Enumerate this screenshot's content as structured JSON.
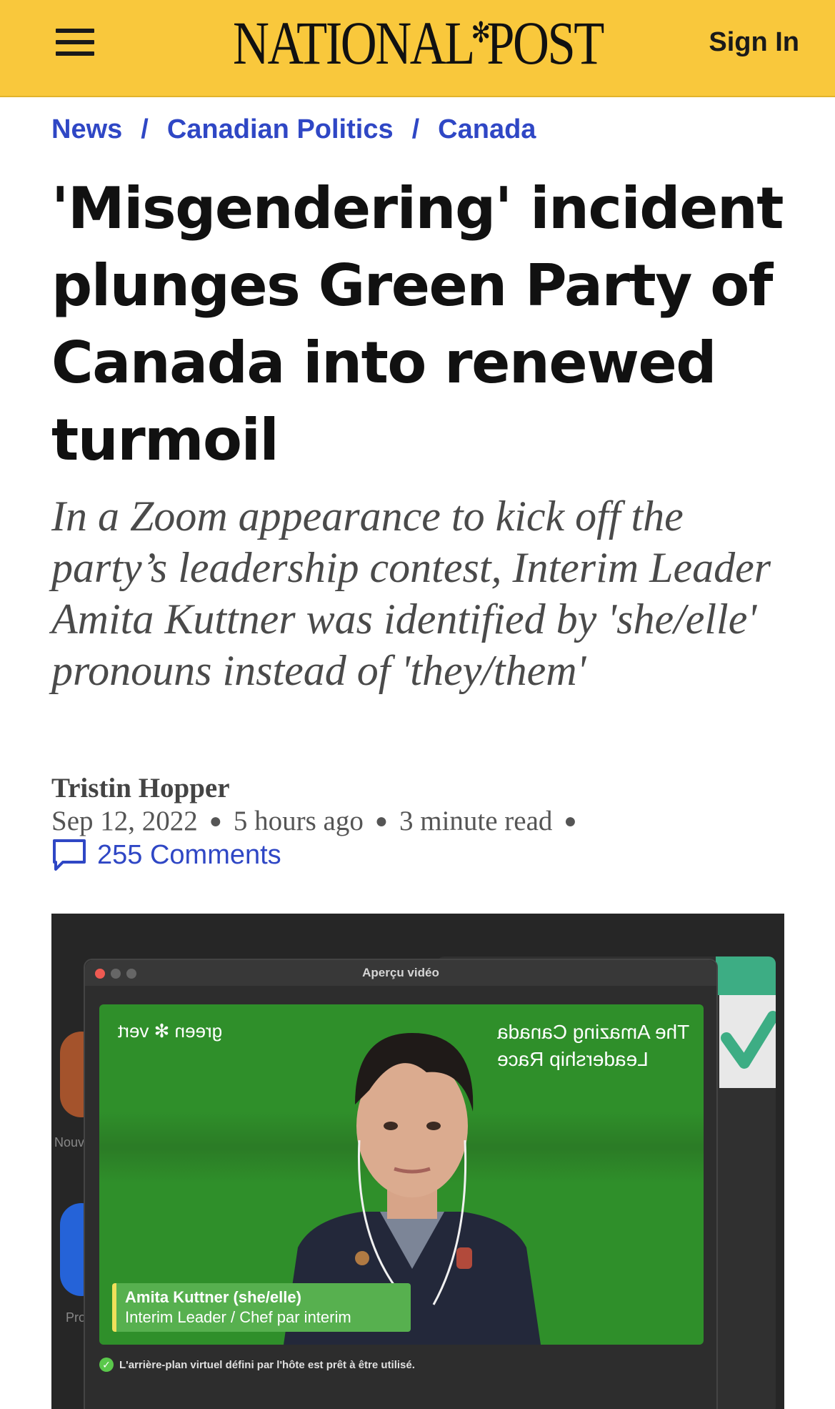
{
  "header": {
    "menu_icon": "hamburger-menu-icon",
    "logo_left": "NATIONAL",
    "logo_leaf": "✻",
    "logo_right": "POST",
    "sign_in": "Sign In",
    "bg_color": "#f9c83c"
  },
  "breadcrumb": {
    "items": [
      "News",
      "Canadian Politics",
      "Canada"
    ],
    "separator": "/",
    "link_color": "#2f47c5"
  },
  "article": {
    "headline": "'Misgendering' incident plunges Green Party of Canada into renewed turmoil",
    "subheadline": "In a Zoom appearance to kick off the party’s leadership contest, Interim Leader Amita Kuttner was identified by 'she/elle' pronouns instead of 'they/them'",
    "author": "Tristin Hopper",
    "date": "Sep 12, 2022",
    "time_ago": "5 hours ago",
    "read_time": "3 minute read",
    "comments_icon": "speech-bubble-icon",
    "comments": "255 Comments"
  },
  "image": {
    "window_title": "Aperçu vidéo",
    "green_logo": "green ✻ vert",
    "race_line1": "The Amazing Canada",
    "race_line2": "Leadership Race",
    "left_label_1": "Nouv",
    "left_label_2": "Pro",
    "caption_name": "Amita Kuttner (she/elle)",
    "caption_title": "Interim Leader / Chef par interim",
    "notice": "L'arrière-plan virtuel défini par l'hôte est prêt à être utilisé."
  }
}
